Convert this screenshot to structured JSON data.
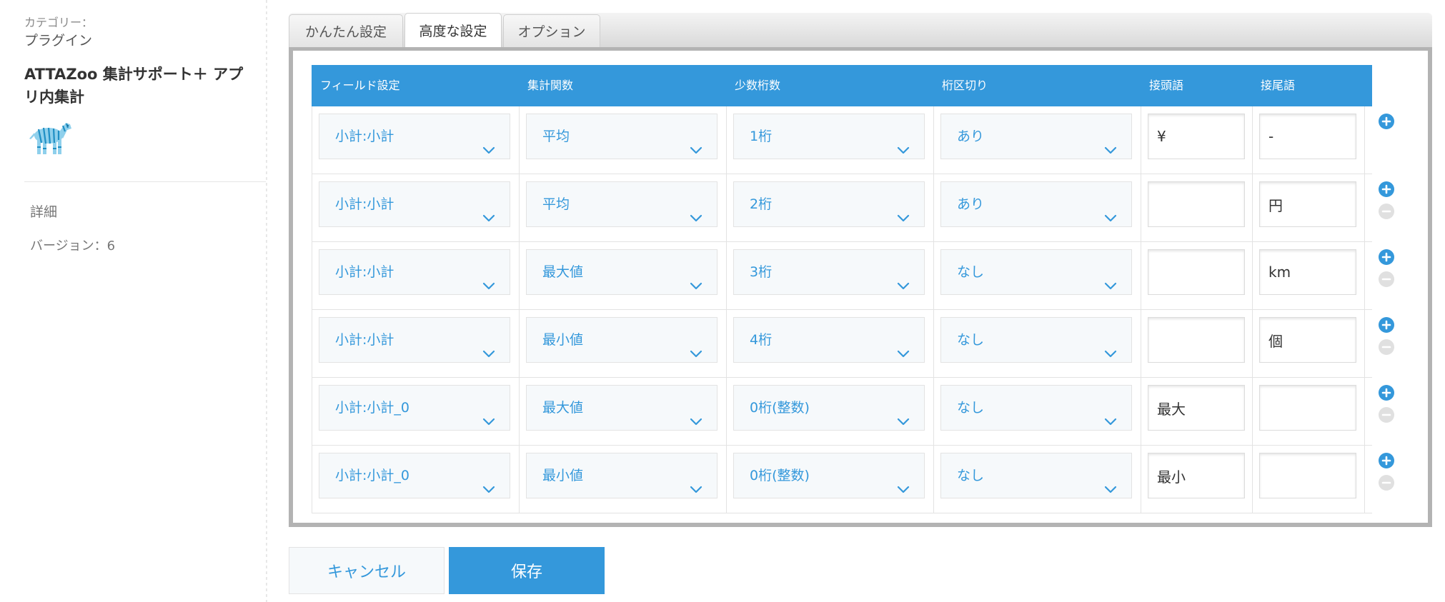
{
  "sidebar": {
    "category_label": "カテゴリー：",
    "category_value": "プラグイン",
    "plugin_name": "ATTAZoo 集計サポート＋ アプリ内集計",
    "icon": "zebra-icon",
    "detail_link": "詳細",
    "version": "バージョン：6"
  },
  "tabs": [
    {
      "label": "かんたん設定",
      "active": false
    },
    {
      "label": "高度な設定",
      "active": true
    },
    {
      "label": "オプション",
      "active": false
    }
  ],
  "table": {
    "headers": [
      "フィールド設定",
      "集計関数",
      "少数桁数",
      "桁区切り",
      "接頭語",
      "接尾語"
    ],
    "rows": [
      {
        "field": "小計:小計",
        "func": "平均",
        "digits": "1桁",
        "separator": "あり",
        "prefix": "¥",
        "suffix": "-"
      },
      {
        "field": "小計:小計",
        "func": "平均",
        "digits": "2桁",
        "separator": "あり",
        "prefix": "",
        "suffix": "円"
      },
      {
        "field": "小計:小計",
        "func": "最大値",
        "digits": "3桁",
        "separator": "なし",
        "prefix": "",
        "suffix": "km"
      },
      {
        "field": "小計:小計",
        "func": "最小値",
        "digits": "4桁",
        "separator": "なし",
        "prefix": "",
        "suffix": "個"
      },
      {
        "field": "小計:小計_0",
        "func": "最大値",
        "digits": "0桁(整数)",
        "separator": "なし",
        "prefix": "最大",
        "suffix": ""
      },
      {
        "field": "小計:小計_0",
        "func": "最小値",
        "digits": "0桁(整数)",
        "separator": "なし",
        "prefix": "最小",
        "suffix": ""
      }
    ]
  },
  "buttons": {
    "cancel": "キャンセル",
    "save": "保存"
  },
  "colors": {
    "accent": "#3498db",
    "panel_border": "#b3b3b3"
  }
}
